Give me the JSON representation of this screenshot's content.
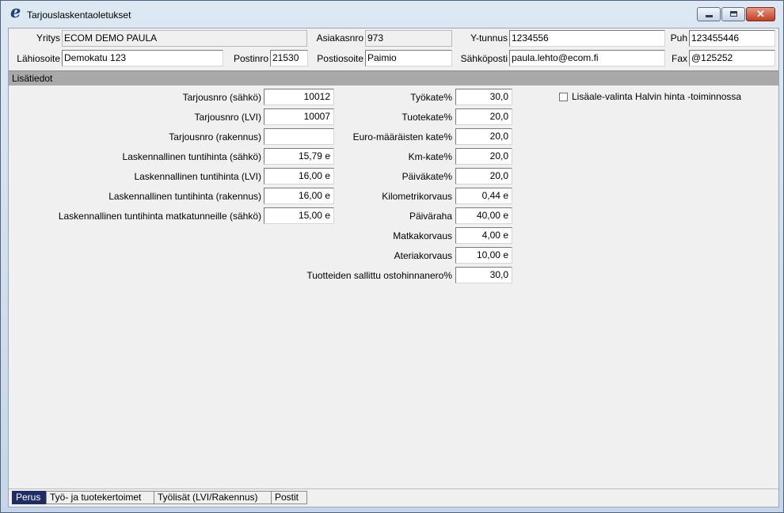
{
  "window": {
    "app_logo": "e",
    "title": "Tarjouslaskentaoletukset",
    "close_glyph": "✕"
  },
  "company": {
    "yritys_label": "Yritys",
    "yritys_value": "ECOM DEMO PAULA",
    "asiakasnro_label": "Asiakasnro",
    "asiakasnro_value": "973",
    "ytunnus_label": "Y-tunnus",
    "ytunnus_value": "1234556",
    "puh_label": "Puh",
    "puh_value": "123455446",
    "lahiosoite_label": "Lähiosoite",
    "lahiosoite_value": "Demokatu 123",
    "postinro_label": "Postinro",
    "postinro_value": "21530",
    "postiosoite_label": "Postiosoite",
    "postiosoite_value": "Paimio",
    "sahkoposti_label": "Sähköposti",
    "sahkoposti_value": "paula.lehto@ecom.fi",
    "fax_label": "Fax",
    "fax_value": "@125252"
  },
  "section_title": "Lisätiedot",
  "left_fields": [
    {
      "label": "Tarjousnro (sähkö)",
      "value": "10012"
    },
    {
      "label": "Tarjousnro (LVI)",
      "value": "10007"
    },
    {
      "label": "Tarjousnro (rakennus)",
      "value": ""
    },
    {
      "label": "Laskennallinen tuntihinta (sähkö)",
      "value": "15,79 e"
    },
    {
      "label": "Laskennallinen tuntihinta (LVI)",
      "value": "16,00 e"
    },
    {
      "label": "Laskennallinen tuntihinta (rakennus)",
      "value": "16,00 e"
    },
    {
      "label": "Laskennallinen tuntihinta matkatunneille (sähkö)",
      "value": "15,00 e"
    }
  ],
  "right_fields": [
    {
      "label": "Työkate%",
      "value": "30,0"
    },
    {
      "label": "Tuotekate%",
      "value": "20,0"
    },
    {
      "label": "Euro-määräisten kate%",
      "value": "20,0"
    },
    {
      "label": "Km-kate%",
      "value": "20,0"
    },
    {
      "label": "Päiväkate%",
      "value": "20,0"
    },
    {
      "label": "Kilometrikorvaus",
      "value": "0,44 e"
    },
    {
      "label": "Päiväraha",
      "value": "40,00 e"
    },
    {
      "label": "Matkakorvaus",
      "value": "4,00 e"
    },
    {
      "label": "Ateriakorvaus",
      "value": "10,00 e"
    },
    {
      "label": "Tuotteiden sallittu ostohinnanero%",
      "value": "30,0"
    }
  ],
  "option": {
    "label": "Lisäale-valinta Halvin hinta -toiminnossa",
    "checked": false
  },
  "tabs": [
    {
      "label": "Perus",
      "active": true
    },
    {
      "label": "Työ- ja tuotekertoimet",
      "active": false
    },
    {
      "label": "Työlisät (LVI/Rakennus)",
      "active": false
    },
    {
      "label": "Postit",
      "active": false
    }
  ]
}
